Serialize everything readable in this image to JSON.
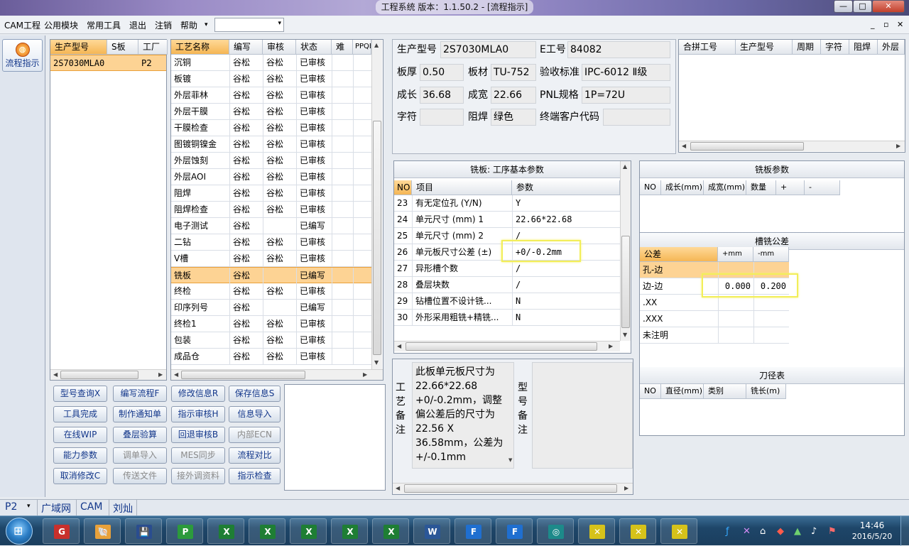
{
  "window": {
    "title": "工程系统  版本：1.1.50.2 - [流程指示]",
    "min": "—",
    "max": "□",
    "close": "✕"
  },
  "menu": {
    "items": [
      "CAM工程",
      "公用模块",
      "常用工具",
      "退出",
      "注销",
      "帮助"
    ],
    "combo_value": "",
    "mdi": {
      "min": "_",
      "restore": "▫",
      "close": "✕"
    }
  },
  "sidebar": {
    "button_label": "流程指示"
  },
  "model_list": {
    "headers": [
      "生产型号",
      "S板",
      "工厂"
    ],
    "rows": [
      {
        "model": "2S7030MLA0",
        "s": "",
        "factory": "P2"
      }
    ]
  },
  "process_list": {
    "headers": [
      "工艺名称",
      "编写",
      "审核",
      "状态",
      "难",
      "PPQE"
    ],
    "rows": [
      {
        "name": "沉铜",
        "writer": "谷松",
        "reviewer": "谷松",
        "status": "已审核"
      },
      {
        "name": "板镀",
        "writer": "谷松",
        "reviewer": "谷松",
        "status": "已审核"
      },
      {
        "name": "外层菲林",
        "writer": "谷松",
        "reviewer": "谷松",
        "status": "已审核"
      },
      {
        "name": "外层干膜",
        "writer": "谷松",
        "reviewer": "谷松",
        "status": "已审核"
      },
      {
        "name": "干膜检查",
        "writer": "谷松",
        "reviewer": "谷松",
        "status": "已审核"
      },
      {
        "name": "图镀铜镍金",
        "writer": "谷松",
        "reviewer": "谷松",
        "status": "已审核"
      },
      {
        "name": "外层蚀刻",
        "writer": "谷松",
        "reviewer": "谷松",
        "status": "已审核"
      },
      {
        "name": "外层AOI",
        "writer": "谷松",
        "reviewer": "谷松",
        "status": "已审核"
      },
      {
        "name": "阻焊",
        "writer": "谷松",
        "reviewer": "谷松",
        "status": "已审核"
      },
      {
        "name": "阻焊检查",
        "writer": "谷松",
        "reviewer": "谷松",
        "status": "已审核"
      },
      {
        "name": "电子测试",
        "writer": "谷松",
        "reviewer": "",
        "status": "已编写"
      },
      {
        "name": "二钻",
        "writer": "谷松",
        "reviewer": "谷松",
        "status": "已审核"
      },
      {
        "name": "V槽",
        "writer": "谷松",
        "reviewer": "谷松",
        "status": "已审核"
      },
      {
        "name": "铣板",
        "writer": "谷松",
        "reviewer": "",
        "status": "已编写"
      },
      {
        "name": "终检",
        "writer": "谷松",
        "reviewer": "谷松",
        "status": "已审核"
      },
      {
        "name": "印序列号",
        "writer": "谷松",
        "reviewer": "",
        "status": "已编写"
      },
      {
        "name": "终检1",
        "writer": "谷松",
        "reviewer": "谷松",
        "status": "已审核"
      },
      {
        "name": "包装",
        "writer": "谷松",
        "reviewer": "谷松",
        "status": "已审核"
      },
      {
        "name": "成品仓",
        "writer": "谷松",
        "reviewer": "谷松",
        "status": "已审核"
      }
    ]
  },
  "actions": [
    [
      "型号查询X",
      "编写流程F",
      "修改信息R",
      "保存信息S"
    ],
    [
      "工具完成",
      "制作通知单",
      "指示审核H",
      "信息导入"
    ],
    [
      "在线WIP",
      "叠层验算",
      "回退审核B",
      "内部ECN"
    ],
    [
      "能力参数",
      "调单导入",
      "MES同步",
      "流程对比"
    ],
    [
      "取消修改C",
      "传送文件",
      "接外调资料",
      "指示检查"
    ]
  ],
  "info": {
    "model_label": "生产型号",
    "model_value": "2S7030MLA0",
    "eno_label": "E工号",
    "eno_value": "84082",
    "thickness_label": "板厚",
    "thickness_value": "0.50",
    "material_label": "板材",
    "material_value": "TU-752",
    "standard_label": "验收标准",
    "standard_value": "IPC-6012 Ⅱ级",
    "length_label": "成长",
    "length_value": "36.68",
    "width_label": "成宽",
    "width_value": "22.66",
    "pnl_label": "PNL规格",
    "pnl_value": "1P=72U",
    "char_label": "字符",
    "char_value": "",
    "mask_label": "阻焊",
    "mask_value": "绿色",
    "customer_label": "终端客户代码",
    "customer_value": ""
  },
  "combined": {
    "headers": [
      "合拼工号",
      "生产型号",
      "周期",
      "字符",
      "阻焊",
      "外层"
    ]
  },
  "params": {
    "title": "铣板: 工序基本参数",
    "headers": [
      "NO",
      "项目",
      "参数"
    ],
    "rows": [
      {
        "no": "23",
        "item": "有无定位孔 (Y/N)",
        "value": "Y"
      },
      {
        "no": "24",
        "item": "单元尺寸 (mm) 1",
        "value": "22.66*22.68"
      },
      {
        "no": "25",
        "item": "单元尺寸 (mm) 2",
        "value": "/"
      },
      {
        "no": "26",
        "item": "单元板尺寸公差 (±)",
        "value": "+0/-0.2mm"
      },
      {
        "no": "27",
        "item": "异形槽个数",
        "value": "/"
      },
      {
        "no": "28",
        "item": "叠层块数",
        "value": "/"
      },
      {
        "no": "29",
        "item": "钻槽位置不设计铣...",
        "value": "N"
      },
      {
        "no": "30",
        "item": "外形采用粗铣+精铣...",
        "value": "N"
      }
    ]
  },
  "mill_params": {
    "title": "铣板参数",
    "headers": [
      "NO",
      "成长(mm)",
      "成宽(mm)",
      "数量",
      "+",
      "-"
    ]
  },
  "slot_tolerance": {
    "title": "槽铣公差",
    "headers": [
      "公差",
      "+mm",
      "-mm"
    ],
    "rows": [
      {
        "name": "孔-边",
        "plus": "",
        "minus": ""
      },
      {
        "name": "边-边",
        "plus": "0.000",
        "minus": "0.200"
      },
      {
        "name": ".XX",
        "plus": "",
        "minus": ""
      },
      {
        "name": ".XXX",
        "plus": "",
        "minus": ""
      },
      {
        "name": "未注明",
        "plus": "",
        "minus": ""
      }
    ]
  },
  "tool_table": {
    "title": "刀径表",
    "headers": [
      "NO",
      "直径(mm)",
      "类别",
      "铣长(m)"
    ]
  },
  "remark": {
    "label": "工\n艺\n备\n注",
    "text": "此板单元板尺寸为22.66*22.68 +0/-0.2mm，调整偏公差后的尺寸为22.56 X 36.58mm，公差为+/-0.1mm",
    "model_label": "型\n号\n备\n注",
    "model_text": ""
  },
  "status": {
    "site": "P2",
    "net": "广域网",
    "module": "CAM",
    "user": "刘灿"
  },
  "taskbar": {
    "time": "14:46",
    "date": "2016/5/20",
    "apps": [
      "G",
      "🐚",
      "💾",
      "P",
      "X",
      "X",
      "X",
      "X",
      "X",
      "W",
      "F",
      "F",
      "◎",
      "✕",
      "✕",
      "✕"
    ]
  },
  "colors": {
    "accent_orange": "#f5b654",
    "highlight_yellow": "#f2ee59",
    "link_blue": "#12368a"
  }
}
